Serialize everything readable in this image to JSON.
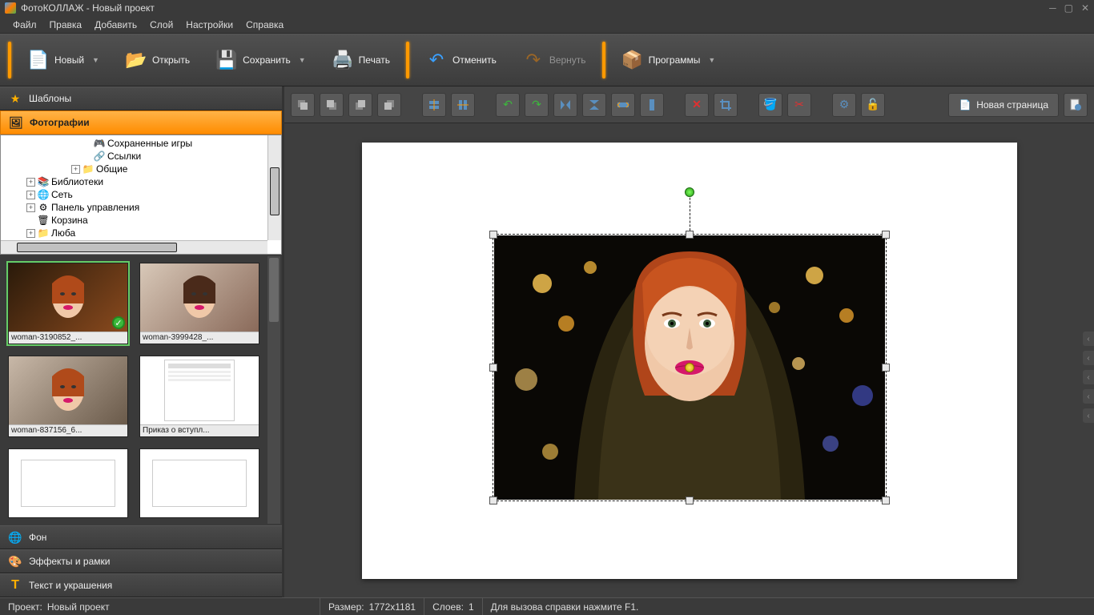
{
  "app": {
    "title": "ФотоКОЛЛАЖ - Новый проект"
  },
  "menubar": [
    "Файл",
    "Правка",
    "Добавить",
    "Слой",
    "Настройки",
    "Справка"
  ],
  "toolbar": {
    "new": "Новый",
    "open": "Открыть",
    "save": "Сохранить",
    "print": "Печать",
    "undo": "Отменить",
    "redo": "Вернуть",
    "programs": "Программы"
  },
  "toolbar2": {
    "new_page": "Новая страница"
  },
  "sidebar": {
    "templates": "Шаблоны",
    "photos": "Фотографии",
    "background": "Фон",
    "effects": "Эффекты и рамки",
    "text": "Текст и украшения"
  },
  "tree": [
    {
      "indent": 7,
      "expand": "",
      "icon": "🎮",
      "label": "Сохраненные игры"
    },
    {
      "indent": 7,
      "expand": "",
      "icon": "🔗",
      "label": "Ссылки"
    },
    {
      "indent": 6,
      "expand": "+",
      "icon": "📁",
      "label": "Общие"
    },
    {
      "indent": 2,
      "expand": "+",
      "icon": "📚",
      "label": "Библиотеки"
    },
    {
      "indent": 2,
      "expand": "+",
      "icon": "🌐",
      "label": "Сеть"
    },
    {
      "indent": 2,
      "expand": "+",
      "icon": "⚙",
      "label": "Панель управления"
    },
    {
      "indent": 2,
      "expand": "",
      "icon": "🗑",
      "label": "Корзина"
    },
    {
      "indent": 2,
      "expand": "+",
      "icon": "📁",
      "label": "Люба"
    }
  ],
  "thumbs": [
    {
      "caption": "woman-3190852_...",
      "selected": true
    },
    {
      "caption": "woman-3999428_..."
    },
    {
      "caption": "woman-837156_6..."
    },
    {
      "caption": "Приказ о вступл..."
    },
    {
      "caption": ""
    },
    {
      "caption": ""
    }
  ],
  "status": {
    "project_label": "Проект:",
    "project_name": "Новый проект",
    "size_label": "Размер:",
    "size_value": "1772x1181",
    "layers_label": "Слоев:",
    "layers_value": "1",
    "hint": "Для вызова справки нажмите F1."
  }
}
